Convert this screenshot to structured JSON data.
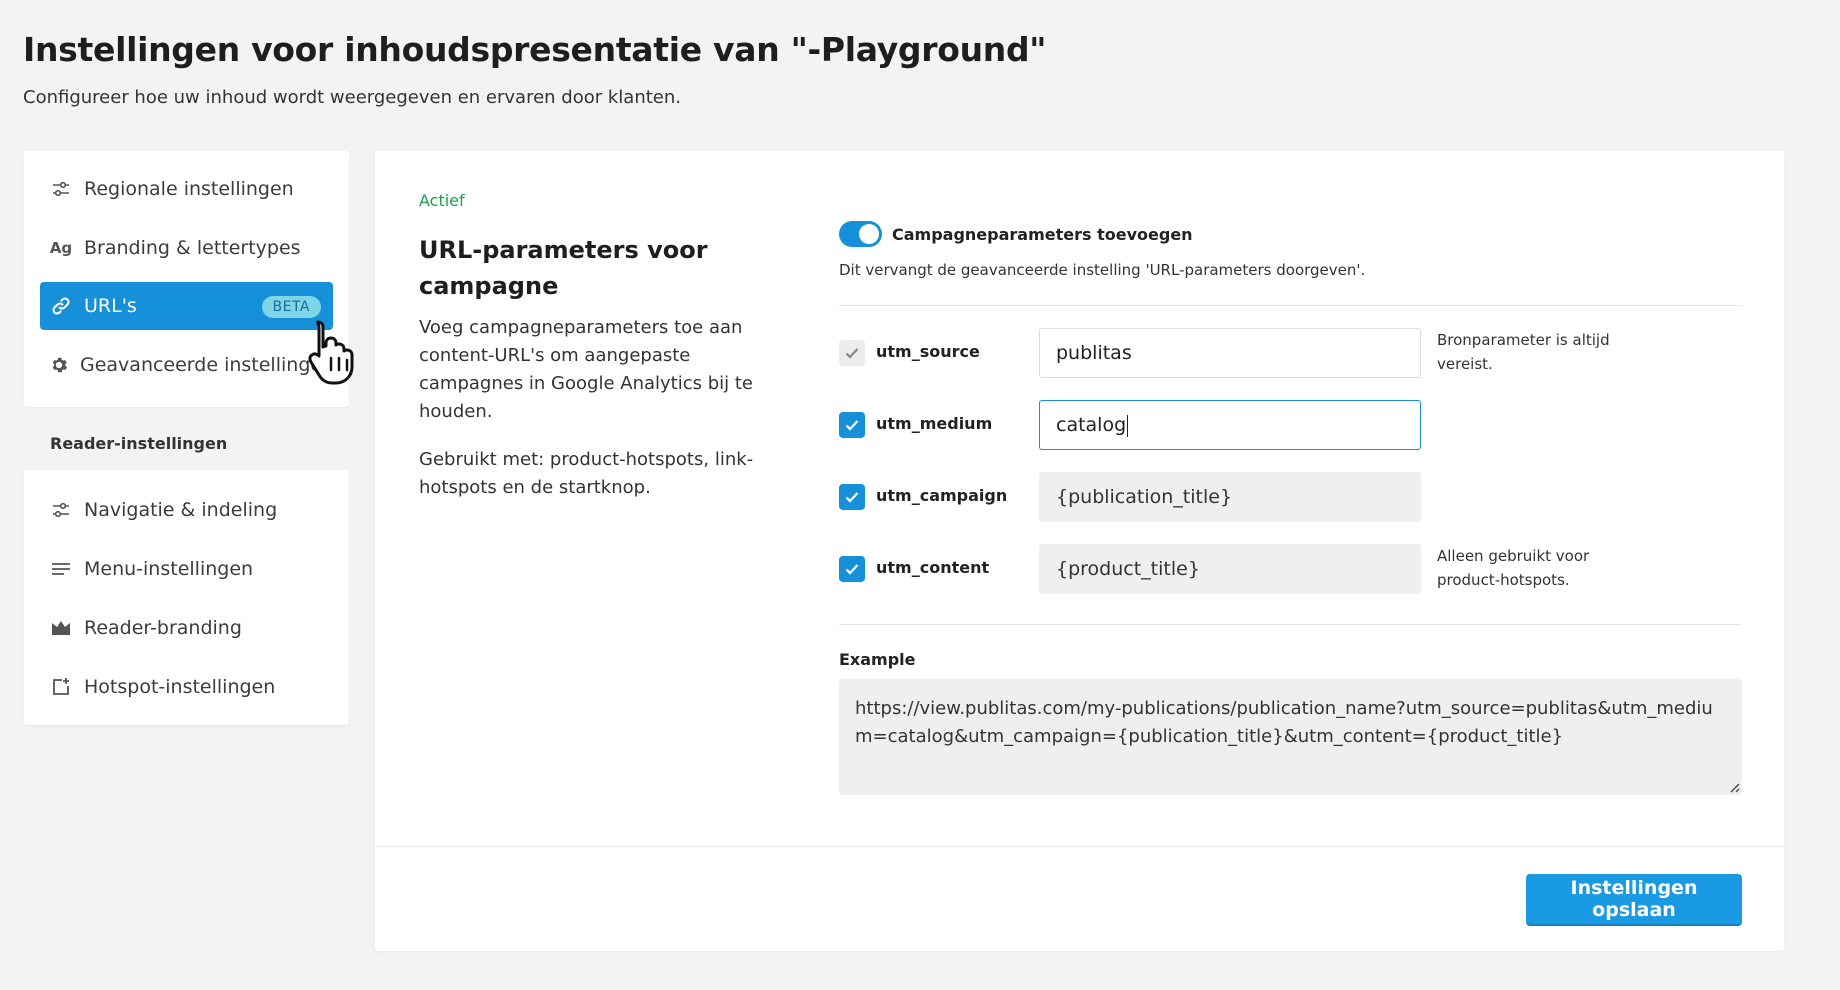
{
  "page": {
    "title": "Instellingen voor inhoudspresentatie van \"-Playground\"",
    "subtitle": "Configureer hoe uw inhoud wordt weergegeven en ervaren door klanten."
  },
  "sidebar": {
    "items": [
      {
        "label": "Regionale instellingen",
        "icon": "sliders-icon"
      },
      {
        "label": "Branding & lettertypes",
        "icon": "font-icon"
      },
      {
        "label": "URL's",
        "icon": "link-icon",
        "badge": "BETA",
        "active": true
      },
      {
        "label": "Geavanceerde instellingen",
        "icon": "gear-icon"
      }
    ],
    "section_label": "Reader-instellingen",
    "reader_items": [
      {
        "label": "Navigatie & indeling",
        "icon": "sliders-icon"
      },
      {
        "label": "Menu-instellingen",
        "icon": "menu-icon"
      },
      {
        "label": "Reader-branding",
        "icon": "crown-icon"
      },
      {
        "label": "Hotspot-instellingen",
        "icon": "hotspot-icon"
      }
    ]
  },
  "main": {
    "status": "Actief",
    "section_title": "URL-parameters voor campagne",
    "description": "Voeg campagneparameters toe aan content-URL's om aangepaste campagnes in Google Analytics bij te houden.",
    "used_with": "Gebruikt met: product-hotspots, link-hotspots en de startknop.",
    "toggle_label": "Campagneparameters toevoegen",
    "toggle_on": true,
    "toggle_help": "Dit vervangt de geavanceerde instelling 'URL-parameters doorgeven'.",
    "params": [
      {
        "name": "utm_source",
        "value": "publitas",
        "checked": true,
        "disabled": true,
        "help": "Bronparameter is altijd vereist."
      },
      {
        "name": "utm_medium",
        "value": "catalog",
        "checked": true,
        "focused": true,
        "help": ""
      },
      {
        "name": "utm_campaign",
        "value": "{publication_title}",
        "checked": true,
        "readonly": true,
        "help": ""
      },
      {
        "name": "utm_content",
        "value": "{product_title}",
        "checked": true,
        "readonly": true,
        "help": "Alleen gebruikt voor product-hotspots."
      }
    ],
    "example_label": "Example",
    "example_value": "https://view.publitas.com/my-publications/publication_name?utm_source=publitas&utm_medium=catalog&utm_campaign={publication_title}&utm_content={product_title}",
    "save_label": "Instellingen opslaan"
  },
  "colors": {
    "accent": "#1690d8",
    "status_green": "#1aa24b",
    "badge_bg": "#7fd5e8"
  }
}
